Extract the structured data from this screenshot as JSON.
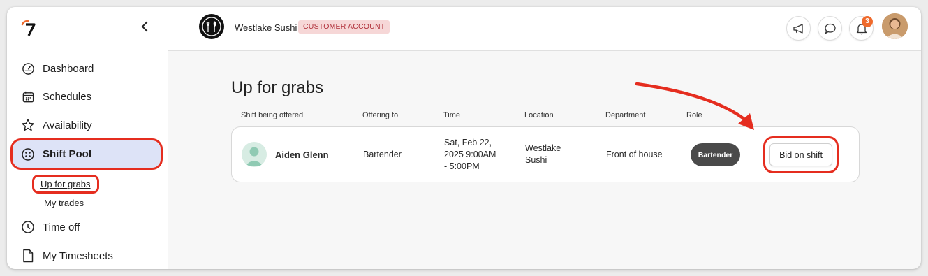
{
  "sidebar": {
    "items": [
      {
        "label": "Dashboard",
        "icon": "dashboard-icon"
      },
      {
        "label": "Schedules",
        "icon": "calendar-icon"
      },
      {
        "label": "Availability",
        "icon": "star-icon"
      },
      {
        "label": "Shift Pool",
        "icon": "shift-pool-icon",
        "active": true
      },
      {
        "label": "Time off",
        "icon": "clock-icon"
      },
      {
        "label": "My Timesheets",
        "icon": "document-icon"
      }
    ],
    "subitems": [
      {
        "label": "Up for grabs",
        "active": true
      },
      {
        "label": "My trades"
      }
    ]
  },
  "header": {
    "company": "Westlake Sushi",
    "account_badge": "CUSTOMER ACCOUNT",
    "notification_count": "3"
  },
  "main": {
    "title": "Up for grabs",
    "columns": [
      "Shift being offered",
      "Offering to",
      "Time",
      "Location",
      "Department",
      "Role"
    ],
    "rows": [
      {
        "name": "Aiden Glenn",
        "offering_to": "Bartender",
        "time_line1": "Sat, Feb 22,",
        "time_line2": "2025 9:00AM",
        "time_line3": "- 5:00PM",
        "location_line1": "Westlake",
        "location_line2": "Sushi",
        "department": "Front of house",
        "role": "Bartender",
        "action": "Bid on shift"
      }
    ]
  },
  "colors": {
    "highlight": "#e52d1f",
    "active_nav_bg": "#dde3f7",
    "badge_bg": "#f6d7d7",
    "badge_text": "#b0303a",
    "role_pill": "#4a4a4a",
    "notification": "#ef6a2c"
  }
}
